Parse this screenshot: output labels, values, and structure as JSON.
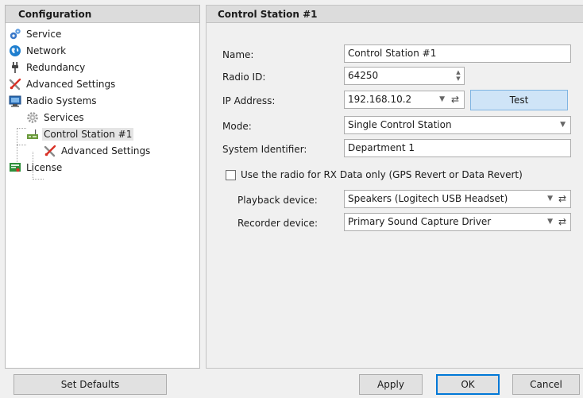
{
  "left": {
    "header": "Configuration",
    "tree": [
      {
        "label": "Service",
        "icon": "gears-icon"
      },
      {
        "label": "Network",
        "icon": "globe-icon"
      },
      {
        "label": "Redundancy",
        "icon": "plug-icon"
      },
      {
        "label": "Advanced Settings",
        "icon": "tools-icon"
      },
      {
        "label": "Radio Systems",
        "icon": "monitor-icon"
      },
      {
        "label": "Services",
        "icon": "gear-icon"
      },
      {
        "label": "Control Station #1",
        "icon": "radio-station-icon"
      },
      {
        "label": "Advanced Settings",
        "icon": "tools-icon"
      },
      {
        "label": "License",
        "icon": "license-icon"
      }
    ],
    "selected": "Control Station #1"
  },
  "right": {
    "header": "Control Station #1",
    "name_label": "Name:",
    "name_value": "Control Station #1",
    "radio_id_label": "Radio ID:",
    "radio_id_value": "64250",
    "ip_label": "IP Address:",
    "ip_value": "192.168.10.2",
    "test_label": "Test",
    "mode_label": "Mode:",
    "mode_value": "Single Control Station",
    "system_id_label": "System Identifier:",
    "system_id_value": "Department 1",
    "rx_checkbox_label": "Use the radio for RX Data only (GPS Revert or Data Revert)",
    "rx_checkbox_checked": false,
    "playback_label": "Playback device:",
    "playback_value": "Speakers (Logitech USB Headset)",
    "recorder_label": "Recorder device:",
    "recorder_value": "Primary Sound Capture Driver"
  },
  "buttons": {
    "set_defaults": "Set Defaults",
    "apply": "Apply",
    "ok": "OK",
    "cancel": "Cancel"
  },
  "colors": {
    "accent": "#0078d7",
    "test_button_bg": "#cfe4f7"
  }
}
